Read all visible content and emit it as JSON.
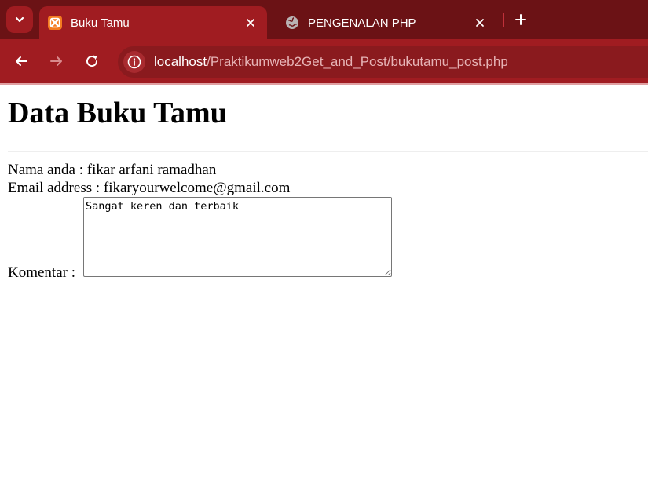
{
  "browser": {
    "tabs": [
      {
        "title": "Buku Tamu",
        "active": true,
        "favicon": "xampp-icon"
      },
      {
        "title": "PENGENALAN PHP",
        "active": false,
        "favicon": "globe-icon"
      }
    ],
    "address": {
      "host": "localhost",
      "path": "/Praktikumweb2Get_and_Post/bukutamu_post.php"
    },
    "colors": {
      "tabstrip": "#6b1215",
      "toolbar": "#a01c21",
      "omnibox": "#8a1a1e",
      "favicon_xampp": "#f47b20"
    }
  },
  "page": {
    "title": "Data Buku Tamu",
    "name_line": "Nama anda : fikar arfani ramadhan",
    "email_line": "Email address : fikaryourwelcome@gmail.com",
    "comment_label": "Komentar :",
    "comment_value": "Sangat keren dan terbaik"
  }
}
